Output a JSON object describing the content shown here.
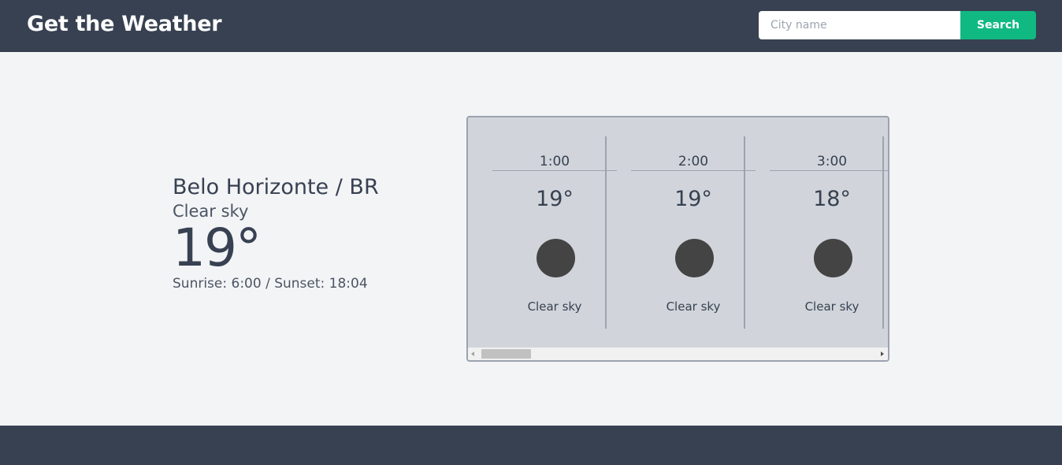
{
  "header": {
    "title": "Get the Weather",
    "search_placeholder": "City name",
    "search_value": "",
    "search_button_label": "Search"
  },
  "current": {
    "location": "Belo Horizonte / BR",
    "description": "Clear sky",
    "temperature": "19°",
    "sun_times": "Sunrise: 6:00 / Sunset: 18:04"
  },
  "forecast": {
    "hours": [
      {
        "time": "1:00",
        "temp": "19°",
        "icon": "night-clear-icon",
        "description": "Clear sky"
      },
      {
        "time": "2:00",
        "temp": "19°",
        "icon": "night-clear-icon",
        "description": "Clear sky"
      },
      {
        "time": "3:00",
        "temp": "18°",
        "icon": "night-clear-icon",
        "description": "Clear sky"
      }
    ],
    "scroll_position": 0.0
  },
  "colors": {
    "header_bg": "#374151",
    "accent": "#10b981",
    "page_bg": "#f3f4f6",
    "card_bg": "#d1d5db"
  }
}
